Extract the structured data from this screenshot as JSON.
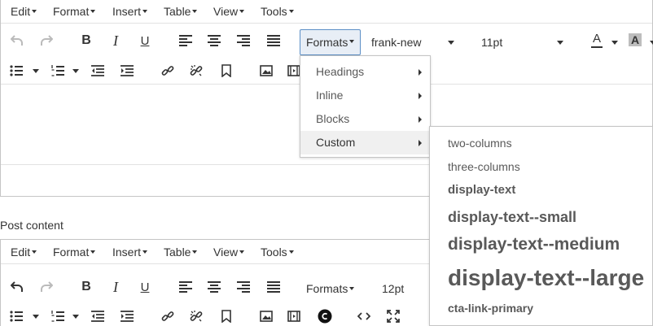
{
  "menubar": {
    "items": [
      "Edit",
      "Format",
      "Insert",
      "Table",
      "View",
      "Tools"
    ]
  },
  "toolbar": {
    "formats_label": "Formats",
    "font_family": "frank-new",
    "font_size": "11pt",
    "font_size_2": "12pt",
    "bold": "B",
    "italic": "I",
    "underline": "U",
    "text_color_glyph": "A",
    "bg_color_glyph": "A"
  },
  "label": {
    "post_content": "Post content"
  },
  "formats_menu": {
    "items": [
      {
        "label": "Headings"
      },
      {
        "label": "Inline"
      },
      {
        "label": "Blocks"
      },
      {
        "label": "Custom"
      }
    ]
  },
  "custom_menu": {
    "items": [
      {
        "label": "two-columns"
      },
      {
        "label": "three-columns"
      },
      {
        "label": "display-text"
      },
      {
        "label": "display-text--small"
      },
      {
        "label": "display-text--medium"
      },
      {
        "label": "display-text--large"
      },
      {
        "label": "cta-link-primary"
      }
    ]
  },
  "colors": {
    "accent_border": "#5c8fc6",
    "active_bg": "#e8eef6",
    "text": "#333333",
    "muted": "#595959"
  }
}
